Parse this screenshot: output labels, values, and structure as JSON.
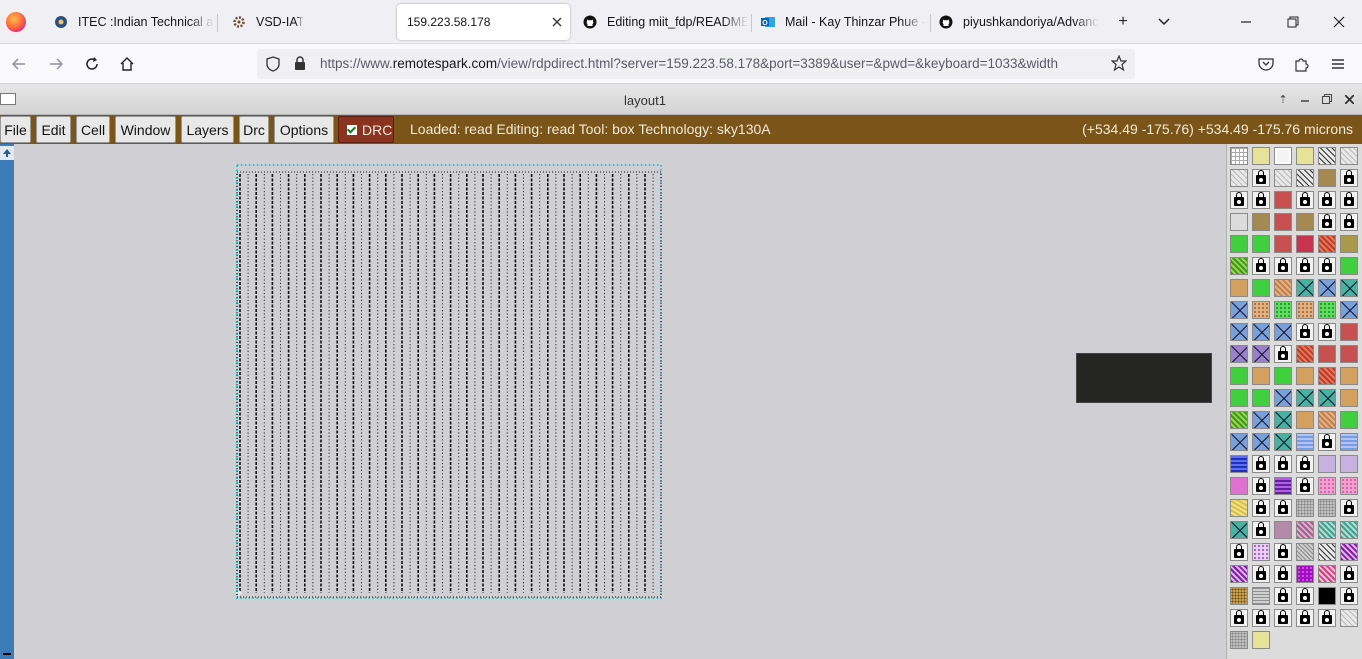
{
  "browser": {
    "tabs": [
      {
        "label": "ITEC :Indian Technical and",
        "icon": "itec-globe-icon",
        "active": false
      },
      {
        "label": "VSD-IAT",
        "icon": "vsd-gear-icon",
        "active": false
      },
      {
        "label": "159.223.58.178",
        "icon": "",
        "active": true
      },
      {
        "label": "Editing miit_fdp/README",
        "icon": "github-icon",
        "active": false
      },
      {
        "label": "Mail - Kay Thinzar Phue -",
        "icon": "outlook-icon",
        "active": false
      },
      {
        "label": "piyushkandoriya/Advanc",
        "icon": "github-icon",
        "active": false
      }
    ],
    "url_prefix": "https://www.",
    "url_domain": "remotespark.com",
    "url_rest": "/view/rdpdirect.html?server=159.223.58.178&port=3389&user=&pwd=&keyboard=1033&width"
  },
  "app": {
    "window_title": "layout1",
    "menus": [
      "File",
      "Edit",
      "Cell",
      "Window",
      "Layers",
      "Drc",
      "Options"
    ],
    "drc_label": "DRC",
    "drc_checked": true,
    "status": "Loaded: read Editing: read Tool: box  Technology: sky130A",
    "coords": "(+534.49 -175.76) +534.49 -175.76 microns"
  },
  "colors": {
    "menubar": "#7a5419",
    "drc_button": "#8a3320",
    "scrollbar": "#3c7cb8",
    "canvas": "#cfcfd4",
    "layout_boundary": "#1fc7d4"
  },
  "palette": [
    [
      "grid",
      "pale-yellow",
      "outline",
      "pale-yellow",
      "dark-diag",
      "light-diag"
    ],
    [
      "light-diag",
      "lock",
      "light-diag",
      "dark-diag",
      "brown",
      "lock"
    ],
    [
      "lock",
      "lock",
      "red",
      "lock",
      "lock",
      "lock"
    ],
    [
      "light-gray",
      "brown",
      "red",
      "brown",
      "lock",
      "lock"
    ],
    [
      "green",
      "green",
      "red",
      "crimson",
      "red-diag",
      "olive"
    ],
    [
      "green-diag",
      "lock",
      "lock",
      "lock",
      "lock",
      "green"
    ],
    [
      "tan",
      "green",
      "tan-diag",
      "x-teal",
      "x-blue",
      "x-teal"
    ],
    [
      "x-blue",
      "tan-dot",
      "green-dot",
      "tan-dot",
      "green-dot",
      "x-blue"
    ],
    [
      "x-blue",
      "x-blue",
      "x-blue",
      "lock",
      "lock",
      "red"
    ],
    [
      "x-purple",
      "x-purple",
      "lock",
      "red-diag",
      "red",
      "red"
    ],
    [
      "green",
      "tan",
      "green",
      "tan",
      "red-diag",
      "tan"
    ],
    [
      "green",
      "green",
      "x-blue",
      "x-teal",
      "x-teal",
      "tan"
    ],
    [
      "green-diag",
      "x-blue",
      "x-teal",
      "tan",
      "tan-diag",
      "green"
    ],
    [
      "x-blue",
      "x-blue",
      "x-teal",
      "blue-wave",
      "lock",
      "blue-wave"
    ],
    [
      "blue-wave-dark",
      "lock",
      "lock",
      "lock",
      "lavender",
      "lavender"
    ],
    [
      "pink",
      "lock",
      "purple-wave",
      "lock",
      "pink-dot",
      "pink-dot"
    ],
    [
      "yellow-wave",
      "lock",
      "lock",
      "gray-dot",
      "gray-dot",
      "lock"
    ],
    [
      "x-teal",
      "lock",
      "mauve",
      "mauve-diag",
      "teal-diag",
      "teal-diag"
    ],
    [
      "lock",
      "lavender-dot",
      "lock",
      "gray-diag",
      "dark-diag",
      "purple-diag"
    ],
    [
      "purple-diag",
      "lock",
      "lock",
      "magenta",
      "pink-diag",
      "lock"
    ],
    [
      "gold-dot",
      "gray-wave",
      "lock",
      "lock",
      "black",
      "lock"
    ],
    [
      "lock",
      "lock",
      "lock",
      "lock",
      "lock",
      "light-diag"
    ],
    [
      "gray-dot",
      "pale-yellow"
    ]
  ]
}
